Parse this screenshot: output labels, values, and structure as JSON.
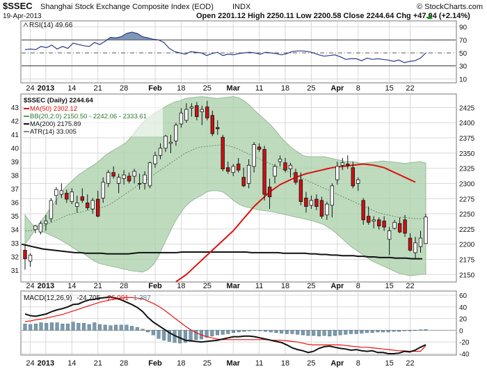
{
  "header": {
    "symbol": "$SSEC",
    "name": "Shanghai Stock Exchange Composite Index (EOD)",
    "exchange": "INDX",
    "copyright": "© StockCharts.com",
    "date": "19-Apr-2013",
    "quote": "Open 2201.12  High 2250.11  Low 2200.58  Close 2244.64  Chg +47.04 (+2.14%)",
    "quote_arrow": "▲"
  },
  "rsi": {
    "label": "RSI(14) 49.66",
    "ticks": [
      "90",
      "70",
      "50",
      "30",
      "10"
    ],
    "values": [
      55,
      56,
      55,
      60,
      58,
      62,
      56,
      60,
      57,
      65,
      63,
      61,
      60,
      66,
      63,
      68,
      74,
      73,
      75,
      80,
      82,
      80,
      75,
      73,
      71,
      70,
      66,
      57,
      52,
      50,
      48,
      52,
      51,
      50,
      46,
      49,
      51,
      46,
      48,
      47,
      49,
      50,
      51,
      50,
      48,
      51,
      50,
      49,
      47,
      49,
      52,
      53,
      53,
      52,
      50,
      47,
      45,
      46,
      47,
      44,
      40,
      41,
      41,
      38,
      42,
      40,
      41,
      40,
      39,
      37,
      39,
      35,
      37,
      38,
      42,
      50
    ]
  },
  "price_panel": {
    "legend": {
      "title": "$SSEC (Daily) 2244.64",
      "ma50": "MA(50) 2302.12",
      "bb": "BB(20,2.0) 2150.50 - 2242.06 - 2333.61",
      "ma200": "MA(200) 2175.89",
      "atr": "ATR(14) 33.005"
    },
    "left_ticks": [
      "43",
      "42",
      "41",
      "40",
      "39",
      "38",
      "37",
      "36",
      "35",
      "34",
      "33",
      "32",
      "31"
    ],
    "right_ticks": [
      "2425",
      "2400",
      "2375",
      "2350",
      "2325",
      "2300",
      "2275",
      "2250",
      "2225",
      "2200",
      "2175",
      "2150"
    ]
  },
  "macd": {
    "label_prefix": "MACD(12,26,9)",
    "macd_value": "-24.705",
    "signal_value": "-26.091",
    "hist_value": "1.387",
    "ticks": [
      "60",
      "40",
      "20",
      "0",
      "-20",
      "-40"
    ],
    "hist": [
      11,
      10,
      11,
      13,
      12,
      13,
      13,
      11,
      11,
      14,
      12,
      12,
      10,
      13,
      10,
      9,
      8,
      9,
      9,
      9,
      7,
      5,
      2,
      -3,
      -8,
      -14,
      -17,
      -19,
      -21,
      -22,
      -21,
      -19,
      -16,
      -15,
      -12,
      -10,
      -8,
      -7,
      -6,
      -4,
      -3,
      -2,
      -1,
      0,
      -1,
      -2,
      -3,
      -4,
      -5,
      -6,
      -6,
      -7,
      -8,
      -9,
      -9,
      -10,
      -9,
      -10,
      -9,
      -8,
      -7,
      -6,
      -6,
      -5,
      -4,
      -4,
      -3,
      -3,
      -3,
      -2,
      -2,
      -1,
      -1,
      0,
      1,
      1.4
    ],
    "macd_line": [
      28,
      25,
      24,
      26,
      28,
      32,
      35,
      37,
      40,
      44,
      45,
      49,
      52,
      53,
      55,
      56,
      57,
      55,
      52,
      48,
      44,
      39,
      32,
      22,
      14,
      8,
      2,
      -4,
      -9,
      -13,
      -17,
      -18,
      -19,
      -20,
      -19,
      -18,
      -17,
      -15,
      -13,
      -11,
      -11,
      -10,
      -10,
      -11,
      -13,
      -15,
      -17,
      -19,
      -21,
      -25,
      -30,
      -33,
      -35,
      -38,
      -36,
      -31,
      -28,
      -27,
      -29,
      -31,
      -32,
      -34,
      -33,
      -35,
      -36,
      -35,
      -38,
      -38,
      -40,
      -40,
      -39,
      -36,
      -37,
      -34,
      -29,
      -24.7
    ],
    "signal_line": [
      15,
      16,
      18,
      19,
      21,
      23,
      25,
      27,
      30,
      33,
      36,
      39,
      42,
      45,
      48,
      50,
      52,
      54,
      55,
      56,
      56,
      55,
      54,
      50,
      46,
      41,
      35,
      28,
      21,
      14,
      7,
      1,
      -4,
      -8,
      -11,
      -13,
      -15,
      -16,
      -16,
      -16,
      -16,
      -16,
      -16,
      -16,
      -16,
      -16,
      -17,
      -17,
      -17,
      -18,
      -19,
      -20,
      -22,
      -24,
      -25,
      -25,
      -25,
      -25,
      -25,
      -25,
      -26,
      -27,
      -28,
      -29,
      -29,
      -30,
      -31,
      -32,
      -33,
      -34,
      -35,
      -35,
      -36,
      -36,
      -36,
      -26.1
    ]
  },
  "xaxis": {
    "labels": [
      "24",
      "2013",
      "14",
      "21",
      "28",
      "Feb",
      "18",
      "25",
      "Mar",
      "11",
      "18",
      "25",
      "Apr",
      "8",
      "15",
      "22"
    ],
    "bold": [
      "2013",
      "Feb",
      "Mar",
      "Apr"
    ]
  },
  "colors": {
    "up_fill": "#ffffff",
    "down_fill": "#cc1111",
    "bb_fill": "#a8cfa8",
    "ma50": "#dd1111",
    "ma200": "#111111",
    "rsi_line": "#2a3a8a",
    "rsi_fill": "#6a84a8",
    "macd_hist": "#7d9aad",
    "signal": "#ee1111",
    "grid": "#d8d8d8"
  },
  "chart_data": {
    "type": "candlestick",
    "title": "$SSEC (Daily) 2244.64",
    "ylim": [
      2140,
      2445
    ],
    "x_label_candle_index": [
      1,
      4,
      9,
      14,
      19,
      25,
      30,
      35,
      40,
      45,
      50,
      55,
      60,
      64,
      70,
      74
    ],
    "candles": [
      {
        "o": 2190,
        "h": 2200,
        "l": 2158,
        "c": 2176
      },
      {
        "o": 2172,
        "h": 2185,
        "l": 2163,
        "c": 2182
      },
      {
        "o": 2224,
        "h": 2232,
        "l": 2218,
        "c": 2230
      },
      {
        "o": 2220,
        "h": 2238,
        "l": 2216,
        "c": 2234
      },
      {
        "o": 2234,
        "h": 2248,
        "l": 2222,
        "c": 2238
      },
      {
        "o": 2242,
        "h": 2276,
        "l": 2236,
        "c": 2272
      },
      {
        "o": 2280,
        "h": 2294,
        "l": 2265,
        "c": 2290
      },
      {
        "o": 2282,
        "h": 2300,
        "l": 2276,
        "c": 2288
      },
      {
        "o": 2284,
        "h": 2290,
        "l": 2268,
        "c": 2274
      },
      {
        "o": 2270,
        "h": 2292,
        "l": 2266,
        "c": 2286
      },
      {
        "o": 2262,
        "h": 2280,
        "l": 2252,
        "c": 2268
      },
      {
        "o": 2278,
        "h": 2292,
        "l": 2268,
        "c": 2272
      },
      {
        "o": 2268,
        "h": 2282,
        "l": 2256,
        "c": 2260
      },
      {
        "o": 2258,
        "h": 2276,
        "l": 2250,
        "c": 2272
      },
      {
        "o": 2274,
        "h": 2288,
        "l": 2244,
        "c": 2246
      },
      {
        "o": 2276,
        "h": 2310,
        "l": 2268,
        "c": 2302
      },
      {
        "o": 2300,
        "h": 2322,
        "l": 2294,
        "c": 2318
      },
      {
        "o": 2318,
        "h": 2328,
        "l": 2308,
        "c": 2312
      },
      {
        "o": 2300,
        "h": 2316,
        "l": 2284,
        "c": 2310
      },
      {
        "o": 2308,
        "h": 2322,
        "l": 2298,
        "c": 2314
      },
      {
        "o": 2312,
        "h": 2318,
        "l": 2300,
        "c": 2304
      },
      {
        "o": 2312,
        "h": 2324,
        "l": 2300,
        "c": 2320
      },
      {
        "o": 2300,
        "h": 2316,
        "l": 2290,
        "c": 2300
      },
      {
        "o": 2300,
        "h": 2320,
        "l": 2290,
        "c": 2314
      },
      {
        "o": 2296,
        "h": 2336,
        "l": 2292,
        "c": 2334
      },
      {
        "o": 2332,
        "h": 2352,
        "l": 2326,
        "c": 2346
      },
      {
        "o": 2346,
        "h": 2366,
        "l": 2340,
        "c": 2358
      },
      {
        "o": 2358,
        "h": 2380,
        "l": 2352,
        "c": 2378
      },
      {
        "o": 2366,
        "h": 2380,
        "l": 2350,
        "c": 2368
      },
      {
        "o": 2370,
        "h": 2400,
        "l": 2362,
        "c": 2396
      },
      {
        "o": 2398,
        "h": 2424,
        "l": 2392,
        "c": 2416
      },
      {
        "o": 2404,
        "h": 2432,
        "l": 2400,
        "c": 2422
      },
      {
        "o": 2424,
        "h": 2432,
        "l": 2410,
        "c": 2426
      },
      {
        "o": 2428,
        "h": 2434,
        "l": 2404,
        "c": 2410
      },
      {
        "o": 2418,
        "h": 2428,
        "l": 2396,
        "c": 2422
      },
      {
        "o": 2426,
        "h": 2436,
        "l": 2404,
        "c": 2408
      },
      {
        "o": 2412,
        "h": 2420,
        "l": 2378,
        "c": 2382
      },
      {
        "o": 2392,
        "h": 2404,
        "l": 2380,
        "c": 2390
      },
      {
        "o": 2376,
        "h": 2380,
        "l": 2320,
        "c": 2324
      },
      {
        "o": 2326,
        "h": 2336,
        "l": 2316,
        "c": 2320
      },
      {
        "o": 2318,
        "h": 2332,
        "l": 2312,
        "c": 2328
      },
      {
        "o": 2332,
        "h": 2342,
        "l": 2318,
        "c": 2322
      },
      {
        "o": 2310,
        "h": 2326,
        "l": 2294,
        "c": 2296
      },
      {
        "o": 2300,
        "h": 2340,
        "l": 2292,
        "c": 2330
      },
      {
        "o": 2328,
        "h": 2368,
        "l": 2318,
        "c": 2364
      },
      {
        "o": 2360,
        "h": 2366,
        "l": 2352,
        "c": 2356
      },
      {
        "o": 2356,
        "h": 2362,
        "l": 2272,
        "c": 2282
      },
      {
        "o": 2294,
        "h": 2308,
        "l": 2258,
        "c": 2278
      },
      {
        "o": 2312,
        "h": 2332,
        "l": 2300,
        "c": 2328
      },
      {
        "o": 2336,
        "h": 2346,
        "l": 2328,
        "c": 2340
      },
      {
        "o": 2334,
        "h": 2342,
        "l": 2318,
        "c": 2322
      },
      {
        "o": 2324,
        "h": 2334,
        "l": 2310,
        "c": 2330
      },
      {
        "o": 2318,
        "h": 2324,
        "l": 2298,
        "c": 2302
      },
      {
        "o": 2306,
        "h": 2318,
        "l": 2264,
        "c": 2270
      },
      {
        "o": 2276,
        "h": 2286,
        "l": 2252,
        "c": 2262
      },
      {
        "o": 2264,
        "h": 2280,
        "l": 2258,
        "c": 2272
      },
      {
        "o": 2274,
        "h": 2282,
        "l": 2256,
        "c": 2262
      },
      {
        "o": 2272,
        "h": 2278,
        "l": 2242,
        "c": 2246
      },
      {
        "o": 2248,
        "h": 2270,
        "l": 2240,
        "c": 2266
      },
      {
        "o": 2264,
        "h": 2300,
        "l": 2244,
        "c": 2296
      },
      {
        "o": 2306,
        "h": 2336,
        "l": 2298,
        "c": 2328
      },
      {
        "o": 2330,
        "h": 2342,
        "l": 2322,
        "c": 2334
      },
      {
        "o": 2332,
        "h": 2346,
        "l": 2324,
        "c": 2330
      },
      {
        "o": 2326,
        "h": 2336,
        "l": 2292,
        "c": 2296
      },
      {
        "o": 2300,
        "h": 2310,
        "l": 2288,
        "c": 2306
      },
      {
        "o": 2272,
        "h": 2276,
        "l": 2232,
        "c": 2240
      },
      {
        "o": 2246,
        "h": 2262,
        "l": 2232,
        "c": 2236
      },
      {
        "o": 2238,
        "h": 2246,
        "l": 2226,
        "c": 2240
      },
      {
        "o": 2240,
        "h": 2244,
        "l": 2224,
        "c": 2230
      },
      {
        "o": 2238,
        "h": 2246,
        "l": 2222,
        "c": 2228
      },
      {
        "o": 2208,
        "h": 2228,
        "l": 2182,
        "c": 2222
      },
      {
        "o": 2226,
        "h": 2240,
        "l": 2224,
        "c": 2236
      },
      {
        "o": 2234,
        "h": 2244,
        "l": 2218,
        "c": 2220
      },
      {
        "o": 2240,
        "h": 2248,
        "l": 2212,
        "c": 2218
      },
      {
        "o": 2210,
        "h": 2218,
        "l": 2188,
        "c": 2190
      },
      {
        "o": 2186,
        "h": 2212,
        "l": 2176,
        "c": 2202
      },
      {
        "o": 2196,
        "h": 2222,
        "l": 2186,
        "c": 2210
      },
      {
        "o": 2201.12,
        "h": 2250.11,
        "l": 2200.58,
        "c": 2244.64
      }
    ],
    "bb_upper": [
      2200,
      2212,
      2225,
      2238,
      2250,
      2262,
      2275,
      2288,
      2298,
      2306,
      2314,
      2320,
      2326,
      2331,
      2338,
      2346,
      2352,
      2357,
      2362,
      2368,
      2378,
      2390,
      2400,
      2408,
      2414,
      2420,
      2425,
      2430,
      2434,
      2436,
      2440,
      2441,
      2442,
      2443,
      2442,
      2441,
      2440,
      2441,
      2442,
      2443,
      2441,
      2436,
      2429,
      2420,
      2412,
      2404,
      2396,
      2386,
      2375,
      2366,
      2358,
      2352,
      2346,
      2344,
      2344,
      2344,
      2344,
      2342,
      2340,
      2338,
      2336,
      2336,
      2335,
      2333,
      2334,
      2335,
      2336,
      2337,
      2336,
      2335,
      2334,
      2333,
      2334,
      2335,
      2336,
      2333.61
    ],
    "bb_lower": [
      2248,
      2236,
      2226,
      2222,
      2218,
      2214,
      2210,
      2205,
      2200,
      2194,
      2188,
      2184,
      2178,
      2172,
      2168,
      2166,
      2164,
      2162,
      2160,
      2158,
      2156,
      2155,
      2154,
      2158,
      2166,
      2180,
      2200,
      2218,
      2236,
      2250,
      2262,
      2270,
      2276,
      2280,
      2286,
      2288,
      2288,
      2286,
      2280,
      2272,
      2266,
      2262,
      2260,
      2258,
      2256,
      2255,
      2254,
      2252,
      2250,
      2248,
      2246,
      2244,
      2242,
      2240,
      2238,
      2235,
      2232,
      2226,
      2220,
      2212,
      2204,
      2196,
      2190,
      2184,
      2178,
      2172,
      2168,
      2164,
      2160,
      2156,
      2152,
      2150,
      2148,
      2149,
      2150,
      2150.5
    ],
    "ma50": [
      2090,
      2096,
      2102,
      2108,
      2114,
      2120,
      2126,
      2132,
      2138,
      2144,
      2150,
      2158,
      2166,
      2174,
      2182,
      2190,
      2198,
      2206,
      2214,
      2222,
      2232,
      2242,
      2252,
      2262,
      2270,
      2278,
      2286,
      2292,
      2298,
      2302,
      2306,
      2310,
      2313,
      2316,
      2318,
      2320,
      2322,
      2324,
      2326,
      2327,
      2328,
      2329,
      2330,
      2331,
      2332,
      2331,
      2330,
      2328,
      2326,
      2322,
      2318,
      2314,
      2310,
      2306,
      2302.12
    ],
    "ma50_start_index": 21,
    "ma200": [
      2200,
      2198,
      2196,
      2194,
      2192,
      2191,
      2190,
      2189,
      2188,
      2187,
      2186,
      2186,
      2185,
      2185,
      2185,
      2185,
      2184,
      2184,
      2184,
      2184,
      2184,
      2185,
      2186,
      2186,
      2186,
      2186,
      2186,
      2186,
      2186,
      2186,
      2187,
      2187,
      2187,
      2187,
      2187,
      2187,
      2187,
      2187,
      2187,
      2187,
      2187,
      2187,
      2187,
      2186,
      2186,
      2186,
      2186,
      2186,
      2186,
      2185,
      2185,
      2185,
      2185,
      2185,
      2184,
      2184,
      2183,
      2183,
      2182,
      2182,
      2181,
      2181,
      2181,
      2180,
      2180,
      2179,
      2179,
      2178,
      2178,
      2178,
      2177,
      2177,
      2177,
      2176,
      2176,
      2175.89
    ],
    "bb_mid": [
      2222,
      2222,
      2224,
      2228,
      2232,
      2236,
      2240,
      2244,
      2248,
      2250,
      2252,
      2254,
      2256,
      2258,
      2260,
      2262,
      2266,
      2272,
      2278,
      2284,
      2290,
      2296,
      2302,
      2308,
      2314,
      2320,
      2326,
      2332,
      2338,
      2344,
      2350,
      2354,
      2358,
      2360,
      2361,
      2362,
      2363,
      2364,
      2362,
      2360,
      2356,
      2352,
      2348,
      2344,
      2340,
      2336,
      2332,
      2328,
      2324,
      2320,
      2316,
      2312,
      2308,
      2304,
      2300,
      2296,
      2292,
      2288,
      2284,
      2280,
      2276,
      2272,
      2268,
      2264,
      2260,
      2256,
      2252,
      2250,
      2248,
      2246,
      2244,
      2244,
      2243,
      2242,
      2242,
      2242.06
    ]
  }
}
